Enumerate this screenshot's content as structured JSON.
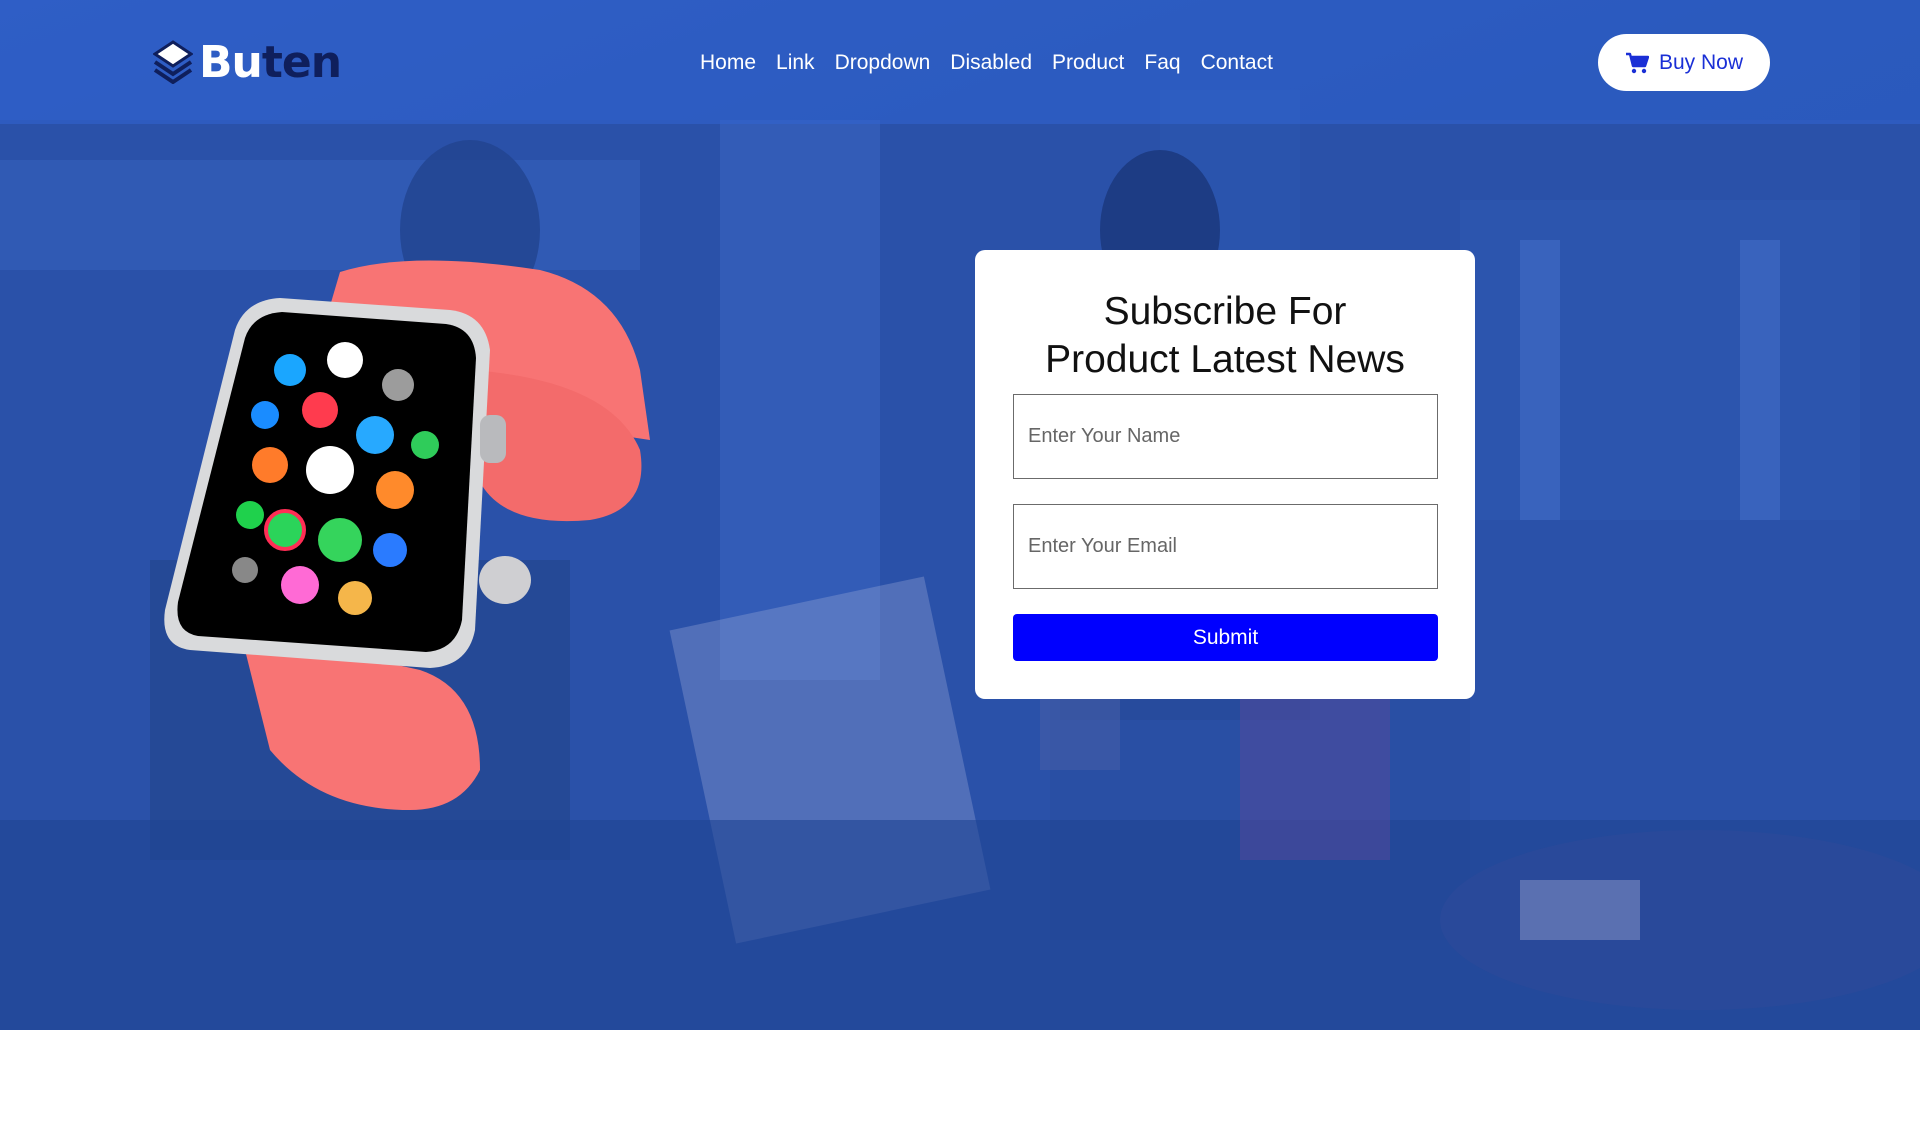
{
  "brand": {
    "name_main": "Bu",
    "name_tail": "ten",
    "icon": "layers-logo-icon"
  },
  "nav": {
    "items": [
      {
        "label": "Home"
      },
      {
        "label": "Link"
      },
      {
        "label": "Dropdown"
      },
      {
        "label": "Disabled"
      },
      {
        "label": "Product"
      },
      {
        "label": "Faq"
      },
      {
        "label": "Contact"
      }
    ]
  },
  "header": {
    "buy_label": "Buy Now",
    "buy_icon": "shopping-cart-icon"
  },
  "subscribe": {
    "title_line1": "Subscribe For",
    "title_line2": "Product Latest News",
    "name_placeholder": "Enter Your Name",
    "email_placeholder": "Enter Your Email",
    "submit_label": "Submit"
  },
  "hero": {
    "product_image": "smartwatch-image"
  },
  "colors": {
    "hero_overlay": "#2a52ad",
    "submit_bg": "#0000ff",
    "buy_text": "#1a2fd6",
    "watch_band": "#f87474"
  }
}
